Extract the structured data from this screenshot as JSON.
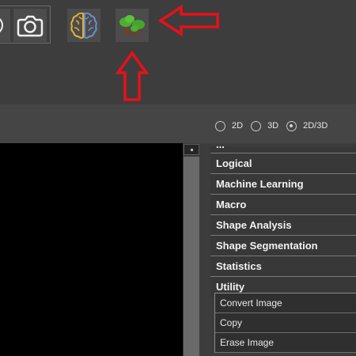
{
  "toolbar": {
    "buttons": [
      {
        "icon": "arrow-right-icon"
      },
      {
        "icon": "camera-icon"
      },
      {
        "icon": "brain-icon"
      },
      {
        "icon": "trees-icon"
      }
    ],
    "annotation_color": "#e8101a"
  },
  "view_mode": {
    "options": [
      {
        "label": "2D",
        "checked": false
      },
      {
        "label": "3D",
        "checked": false
      },
      {
        "label": "2D/3D",
        "checked": true
      }
    ]
  },
  "categories": [
    {
      "label": "..."
    },
    {
      "label": "Logical"
    },
    {
      "label": "Machine Learning"
    },
    {
      "label": "Macro"
    },
    {
      "label": "Shape Analysis"
    },
    {
      "label": "Shape Segmentation"
    },
    {
      "label": "Statistics"
    },
    {
      "label": "Utility"
    }
  ],
  "utility_items": [
    {
      "label": "Convert Image"
    },
    {
      "label": "Copy"
    },
    {
      "label": "Erase Image"
    }
  ]
}
